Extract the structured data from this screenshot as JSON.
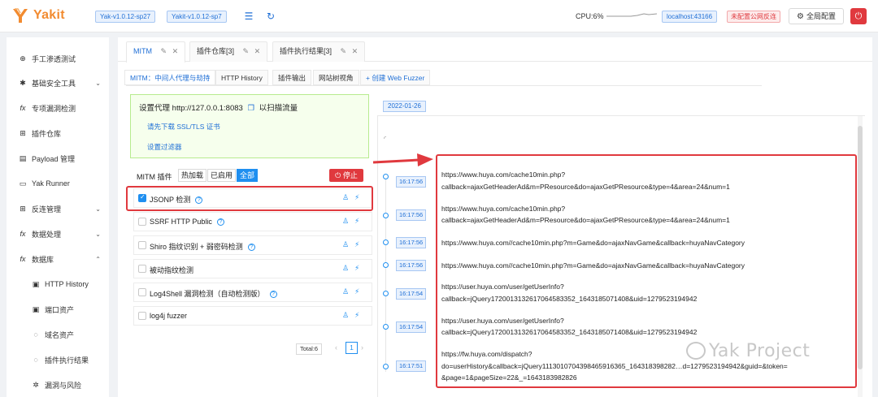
{
  "app": {
    "name": "Yakit",
    "versions": [
      "Yak-v1.0.12-sp27",
      "Yakit-v1.0.12-sp7"
    ],
    "cpu": "CPU:6%",
    "host": "localhost:43166",
    "public_warning": "未配置公网反连",
    "global_config": "全局配置"
  },
  "sidebar": {
    "items": [
      {
        "label": "手工渗透测试",
        "icon": "crosshair-icon",
        "expandable": false
      },
      {
        "label": "基础安全工具",
        "icon": "bug-icon",
        "expandable": true,
        "expanded": false
      },
      {
        "label": "专项漏洞检测",
        "icon": "function-icon",
        "expandable": false
      },
      {
        "label": "插件仓库",
        "icon": "grid-icon",
        "expandable": false
      },
      {
        "label": "Payload 管理",
        "icon": "file-icon",
        "expandable": false
      },
      {
        "label": "Yak Runner",
        "icon": "terminal-icon",
        "expandable": false
      },
      {
        "label": "反连管理",
        "icon": "grid-icon",
        "expandable": true,
        "expanded": false
      },
      {
        "label": "数据处理",
        "icon": "function-icon",
        "expandable": true,
        "expanded": false
      },
      {
        "label": "数据库",
        "icon": "function-icon",
        "expandable": true,
        "expanded": true
      }
    ],
    "subitems": [
      {
        "label": "HTTP History",
        "icon": "history-icon"
      },
      {
        "label": "端口资产",
        "icon": "port-icon"
      },
      {
        "label": "域名资产",
        "icon": "domain-icon"
      },
      {
        "label": "插件执行结果",
        "icon": "result-icon"
      },
      {
        "label": "漏洞与风险",
        "icon": "risk-icon"
      }
    ]
  },
  "tabs": [
    {
      "label": "MITM",
      "active": true
    },
    {
      "label": "插件仓库[3]",
      "active": false
    },
    {
      "label": "插件执行结果[3]",
      "active": false
    }
  ],
  "subtabs": [
    {
      "label": "MITM：中间人代理与劫持",
      "active": true
    },
    {
      "label": "HTTP History",
      "active": false
    },
    {
      "label": "插件输出",
      "active": false
    },
    {
      "label": "网站树视角",
      "active": false
    },
    {
      "label": "+ 创建 Web Fuzzer",
      "active": false
    }
  ],
  "proxy": {
    "prefix": "设置代理",
    "address": "http://127.0.0.1:8083",
    "suffix": "以扫描流量",
    "download_cert": "请先下载 SSL/TLS 证书",
    "filter": "设置过滤器"
  },
  "mitm": {
    "label": "MITM 插件",
    "filters": [
      {
        "label": "热加载",
        "active": false
      },
      {
        "label": "已启用",
        "active": false
      },
      {
        "label": "全部",
        "active": true
      }
    ],
    "stop": "停止",
    "plugins": [
      {
        "name": "JSONP 检测",
        "checked": true,
        "help": true
      },
      {
        "name": "SSRF HTTP Public",
        "checked": false,
        "help": true
      },
      {
        "name": "Shiro 指纹识别 + 弱密码检测",
        "checked": false,
        "help": true
      },
      {
        "name": "被动指纹检测",
        "checked": false,
        "help": false
      },
      {
        "name": "Log4Shell 漏洞检测（自动检测版）",
        "checked": false,
        "help": true
      },
      {
        "name": "log4j fuzzer",
        "checked": false,
        "help": false
      }
    ],
    "total": "Total:6",
    "page": "1"
  },
  "timeline": {
    "date": "2022-01-26",
    "entries": [
      {
        "time": "16:17:56",
        "lines": [
          "https://www.huya.com/cache10min.php?",
          "callback=ajaxGetHeaderAd&m=PResource&do=ajaxGetPResource&type=4&area=24&num=1"
        ]
      },
      {
        "time": "16:17:56",
        "lines": [
          "https://www.huya.com/cache10min.php?",
          "callback=ajaxGetHeaderAd&m=PResource&do=ajaxGetPResource&type=4&area=24&num=1"
        ]
      },
      {
        "time": "16:17:56",
        "lines": [
          "https://www.huya.com//cache10min.php?m=Game&do=ajaxNavGame&callback=huyaNavCategory"
        ]
      },
      {
        "time": "16:17:56",
        "lines": [
          "https://www.huya.com//cache10min.php?m=Game&do=ajaxNavGame&callback=huyaNavCategory"
        ]
      },
      {
        "time": "16:17:54",
        "lines": [
          "https://user.huya.com/user/getUserInfo?",
          "callback=jQuery172001313261706458335​2_1643185071408&uid=1279523194942"
        ]
      },
      {
        "time": "16:17:54",
        "lines": [
          "https://user.huya.com/user/getUserInfo?",
          "callback=jQuery172001313261706458335​2_1643185071408&uid=1279523194942"
        ]
      },
      {
        "time": "16:17:51",
        "lines": [
          "https://fw.huya.com/dispatch?",
          "do=userHistory&callback=jQuery111301070439846591636​5_164318398282…d=1279523194942&guid=&token=",
          "&page=1&pageSize=22&_=1643183982826"
        ]
      }
    ]
  },
  "watermark": "Yak Project",
  "colors": {
    "brand": "#f28b30",
    "accent": "#1f8ff0",
    "danger": "#e0393e"
  }
}
